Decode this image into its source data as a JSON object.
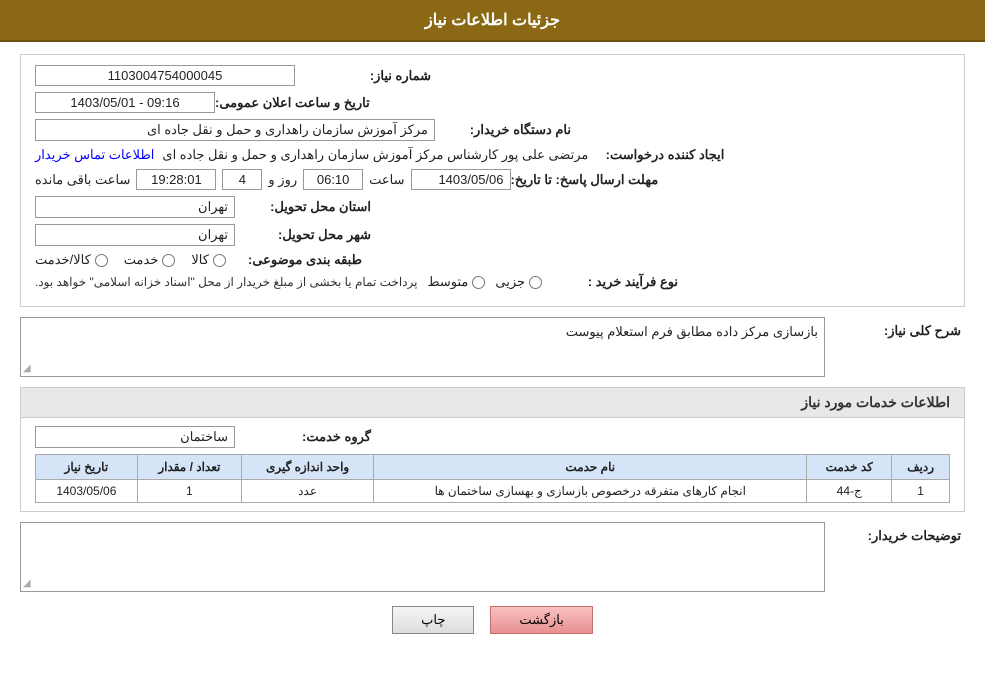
{
  "header": {
    "title": "جزئیات اطلاعات نیاز"
  },
  "fields": {
    "need_number_label": "شماره نیاز:",
    "need_number_value": "1103004754000045",
    "announce_date_label": "تاریخ و ساعت اعلان عمومی:",
    "announce_date_value": "1403/05/01 - 09:16",
    "buyer_org_label": "نام دستگاه خریدار:",
    "buyer_org_value": "مرکز آموزش سازمان راهداری و حمل و نقل جاده ای",
    "requester_label": "ایجاد کننده درخواست:",
    "requester_value": "مرتضی علی پور کارشناس مرکز آموزش سازمان راهداری و حمل و نقل جاده ای",
    "contact_link": "اطلاعات تماس خریدار",
    "response_deadline_label": "مهلت ارسال پاسخ: تا تاریخ:",
    "response_date": "1403/05/06",
    "response_time_label": "ساعت",
    "response_time": "06:10",
    "response_days_label": "روز و",
    "response_days": "4",
    "response_remaining_label": "ساعت باقی مانده",
    "response_remaining_time": "19:28:01",
    "province_label": "استان محل تحویل:",
    "province_value": "تهران",
    "city_label": "شهر محل تحویل:",
    "city_value": "تهران",
    "category_label": "طبقه بندی موضوعی:",
    "radio_kala": "کالا",
    "radio_khedmat": "خدمت",
    "radio_kala_khedmat": "کالا/خدمت",
    "purchase_type_label": "نوع فرآیند خرید :",
    "radio_jozvi": "جزیی",
    "radio_mottavaset": "متوسط",
    "purchase_desc": "پرداخت تمام یا بخشی از مبلغ خریدار از محل \"اسناد خزانه اسلامی\" خواهد بود.",
    "description_section_title": "شرح کلی نیاز:",
    "description_value": "بازسازی مرکز داده مطابق فرم استعلام پیوست",
    "services_section_title": "اطلاعات خدمات مورد نیاز",
    "service_group_label": "گروه خدمت:",
    "service_group_value": "ساختمان",
    "table_headers": {
      "row_num": "ردیف",
      "service_code": "کد خدمت",
      "service_name": "نام حدمت",
      "unit": "واحد اندازه گیری",
      "quantity": "تعداد / مقدار",
      "date": "تاریخ نیاز"
    },
    "table_rows": [
      {
        "row_num": "1",
        "service_code": "ج-44",
        "service_name": "انجام کارهای متفرقه درخصوص بازسازی و بهسازی ساختمان ها",
        "unit": "عدد",
        "quantity": "1",
        "date": "1403/05/06"
      }
    ],
    "buyer_notes_label": "توضیحات خریدار:",
    "buyer_notes_value": ""
  },
  "buttons": {
    "print": "چاپ",
    "back": "بازگشت"
  }
}
